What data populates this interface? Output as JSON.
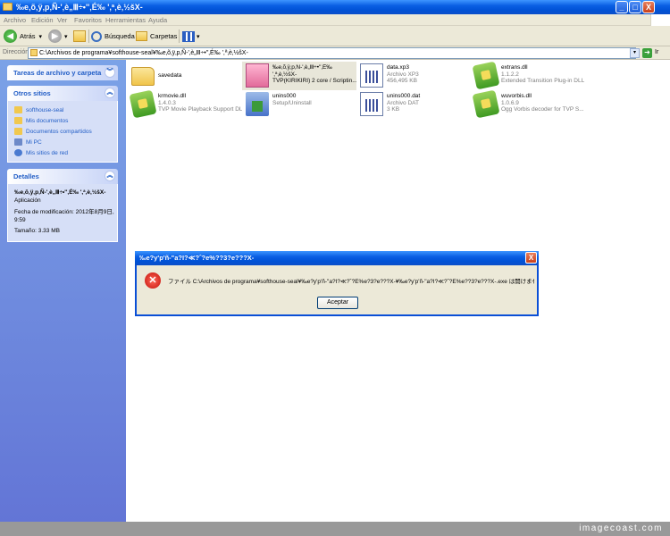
{
  "window": {
    "title": "‰e‚õ‚ÿ‚p‚Ñ-'‚è„Ⅲ÷•''‚É‰ ',ª‚è‚½šX-",
    "min_label": "_",
    "max_label": "□",
    "close_label": "X"
  },
  "menu": [
    "Archivo",
    "Edición",
    "Ver",
    "Favoritos",
    "Herramientas",
    "Ayuda"
  ],
  "toolbar": {
    "back_label": "Atrás",
    "back_glyph": "◀",
    "forward_glyph": "▶",
    "dropdown_glyph": "▾",
    "search_label": "Búsqueda",
    "folders_label": "Carpetas"
  },
  "address": {
    "label": "Dirección",
    "value": "C:\\Archivos de programa¥softhouse-seal¥‰e‚õ‚ÿ‚p‚Ñ-'‚è„Ⅲ÷•''‚É‰ ',ª‚è‚½šX-",
    "go_label": "Ir"
  },
  "sidebar": {
    "tasks_header": "Tareas de archivo y carpeta",
    "other_header": "Otros sitios",
    "other_links": [
      {
        "label": "softhouse-seal",
        "color": "#f1c84e"
      },
      {
        "label": "Mis documentos",
        "color": "#f1c84e"
      },
      {
        "label": "Documentos compartidos",
        "color": "#f1c84e"
      },
      {
        "label": "Mi PC",
        "color": "#6d89c8"
      },
      {
        "label": "Mis sitios de red",
        "color": "#4a7ad0"
      }
    ],
    "details_header": "Detalles",
    "details": {
      "name": "‰e‚õ‚ÿ‚p‚Ñ-'‚è„Ⅲ÷•''‚É‰ ',ª‚è‚½šX-",
      "type": "Aplicación",
      "modified": "Fecha de modificación: 2012年8月9日, 9:59",
      "size": "Tamaño: 3.33 MB"
    },
    "chevron_up": "︽"
  },
  "files": [
    {
      "name": "savedata",
      "line2": "",
      "line3": "",
      "icon": "folder"
    },
    {
      "name": "‰e‚õ‚ÿ‚p‚Ñ-'‚è„Ⅲ÷•''‚É‰",
      "line2": "',ª‚è‚½šX-",
      "line3": "TVP(KIRIKIRI) 2 core / Scriptin...",
      "icon": "exe"
    },
    {
      "name": "data.xp3",
      "line2": "Archivo XP3",
      "line3": "456,495 KB",
      "icon": "xp3"
    },
    {
      "name": "extrans.dll",
      "line2": "1.1.2.2",
      "line3": "Extended Transition Plug-in DLL",
      "icon": "dll"
    },
    {
      "name": "krmovie.dll",
      "line2": "1.4.0.3",
      "line3": "TVP Movie Playback Support DLL",
      "icon": "dll"
    },
    {
      "name": "unins000",
      "line2": "Setup/Uninstall",
      "line3": "",
      "icon": "inst"
    },
    {
      "name": "unins000.dat",
      "line2": "Archivo DAT",
      "line3": "3 KB",
      "icon": "xp3"
    },
    {
      "name": "wuvorbis.dll",
      "line2": "1.0.6.9",
      "line3": "Ogg Vorbis decoder for TVP S...",
      "icon": "dll"
    }
  ],
  "dialog": {
    "title": "‰e?y'p'ñ-\"a?I?≪?ˆ?e%??3?e???X-",
    "message": "ファイル C:\\Archivos de programa¥softhouse-seal¥‰e?y'p'ñ-\"a?I?≪?ˆ?E%e?3?e???X-¥‰e?y'p'ñ-\"a?I?≪?ˆ?E%e??3?e???X-.exe は開けません。",
    "ok_label": "Aceptar",
    "error_glyph": "✕",
    "close_glyph": "X"
  },
  "watermark": "imagecoast.com"
}
